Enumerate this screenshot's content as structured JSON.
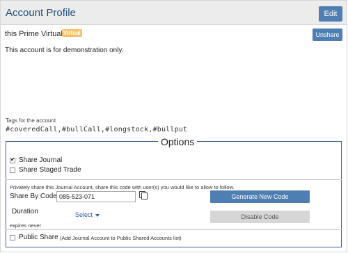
{
  "header": {
    "title": "Account Profile",
    "edit_label": "Edit"
  },
  "account": {
    "name": "this Prime Virtual",
    "badge": "Virtual",
    "unshare_label": "Unshare",
    "description": "This account is for demonstration only."
  },
  "tags": {
    "label": "Tags for the account",
    "value": "#coveredCall,#bullCall,#longstock,#bullput"
  },
  "options": {
    "legend": "Options",
    "share_journal": {
      "label": "Share Journal",
      "checked": true
    },
    "share_staged_trade": {
      "label": "Share Staged Trade",
      "checked": false
    },
    "private_share_text": "Privately share this Journal Account, share this code with user(s) you would like to allow to follow.",
    "share_by_code_label": "Share By Code",
    "share_code": "085-523-071",
    "generate_label": "Generate New Code",
    "duration_label": "Duration",
    "select_label": "Select",
    "expires_text": "expires never",
    "disable_label": "Disable Code",
    "public_share": {
      "label": "Public Share",
      "note": "(Add Journal Account to Public Shared Accounts list)",
      "checked": false
    }
  },
  "colors": {
    "accent": "#4f7fb2",
    "title": "#1f4e79",
    "badge": "#f5c26b",
    "options_border": "#3a5f8c"
  },
  "icons": [
    "check-icon",
    "copy-icon",
    "caret-down-icon"
  ]
}
